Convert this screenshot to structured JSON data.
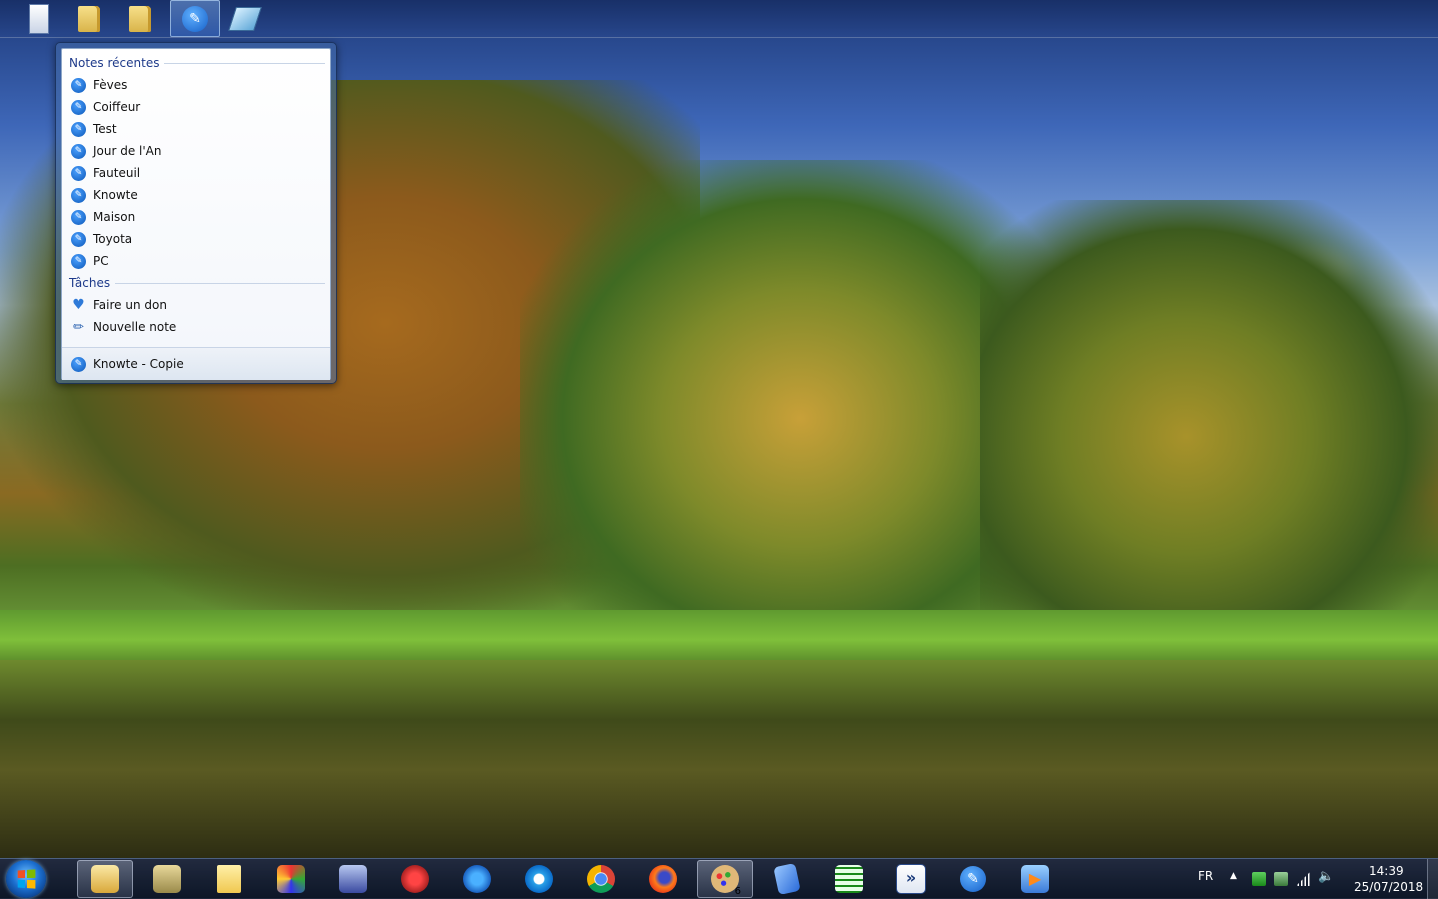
{
  "jump_list": {
    "recent_header": "Notes récentes",
    "recent_items": [
      {
        "label": "Fèves"
      },
      {
        "label": "Coiffeur"
      },
      {
        "label": "Test"
      },
      {
        "label": "Jour de l'An"
      },
      {
        "label": "Fauteuil"
      },
      {
        "label": "Knowte"
      },
      {
        "label": "Maison"
      },
      {
        "label": "Toyota"
      },
      {
        "label": "PC"
      }
    ],
    "tasks_header": "Tâches",
    "tasks": [
      {
        "label": "Faire un don",
        "icon": "heart-icon"
      },
      {
        "label": "Nouvelle note",
        "icon": "pen-icon"
      }
    ],
    "pinned_app": "Knowte - Copie"
  },
  "top_bar": {
    "items": [
      {
        "icon": "notes-list-icon"
      },
      {
        "icon": "folder-icon"
      },
      {
        "icon": "folder-icon"
      },
      {
        "icon": "knowte-pen-icon",
        "active": true
      },
      {
        "icon": "eraser-icon"
      }
    ]
  },
  "taskbar": {
    "items": [
      {
        "icon": "file-explorer-icon",
        "active": true
      },
      {
        "icon": "network-folder-icon"
      },
      {
        "icon": "notepad-icon"
      },
      {
        "icon": "cube-app-icon"
      },
      {
        "icon": "scanner-icon"
      },
      {
        "icon": "ccleaner-icon"
      },
      {
        "icon": "malwarebytes-icon"
      },
      {
        "icon": "internet-explorer-icon"
      },
      {
        "icon": "chrome-icon"
      },
      {
        "icon": "firefox-icon"
      },
      {
        "icon": "paint-palette-icon",
        "active": true,
        "badge": "6"
      },
      {
        "icon": "book-icon"
      },
      {
        "icon": "spreadsheet-grid-icon"
      },
      {
        "icon": "remote-arrows-icon"
      },
      {
        "icon": "knowte-pen-icon"
      },
      {
        "icon": "media-player-icon"
      }
    ],
    "tray": {
      "language": "FR",
      "time": "14:39",
      "date": "25/07/2018"
    }
  },
  "colors": {
    "accent": "#1660c8",
    "jump_header_text": "#1e3a8a"
  }
}
